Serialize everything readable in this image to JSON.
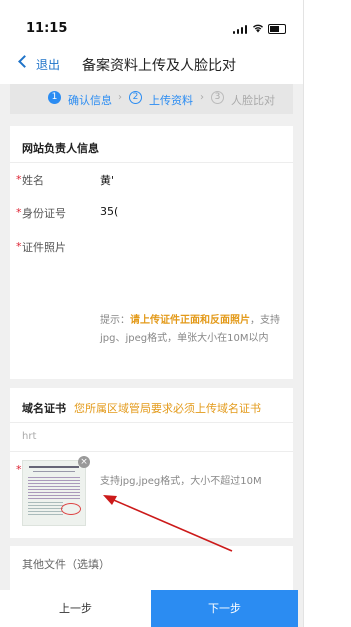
{
  "status_bar": {
    "time": "11:15"
  },
  "nav": {
    "back_label": "退出",
    "title": "备案资料上传及人脸比对"
  },
  "steps": [
    {
      "num": "1",
      "label": "确认信息",
      "state": "done"
    },
    {
      "num": "2",
      "label": "上传资料",
      "state": "active"
    },
    {
      "num": "3",
      "label": "人脸比对",
      "state": "pending"
    }
  ],
  "step_arrow": "›",
  "owner_section": {
    "title": "网站负责人信息",
    "name_label": "姓名",
    "name_value": "黄'",
    "id_label": "身份证号",
    "id_value": "35(",
    "photo_label": "证件照片",
    "hint_prefix": "提示：",
    "hint_emph": "请上传证件正面和反面照片",
    "hint_rest": "，支持jpg、jpeg格式，单张大小在10M以内"
  },
  "domain_section": {
    "title": "域名证书",
    "notice": "您所属区域管局要求必须上传域名证书",
    "domain_value": "hrt",
    "close_icon": "×",
    "upload_hint": "支持jpg,jpeg格式，大小不超过10M"
  },
  "other_section": {
    "title": "其他文件（选填）"
  },
  "footer": {
    "prev_label": "上一步",
    "next_label": "下一步"
  },
  "colors": {
    "accent": "#2b8cf2",
    "orange": "#e39a1a",
    "required": "#dd2233",
    "arrow": "#cc1a1a"
  },
  "required_mark": "*"
}
